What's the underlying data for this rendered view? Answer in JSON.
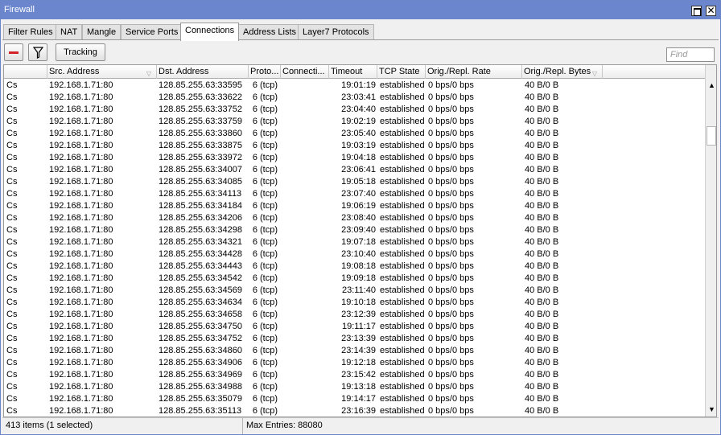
{
  "window": {
    "title": "Firewall"
  },
  "tabs": [
    "Filter Rules",
    "NAT",
    "Mangle",
    "Service Ports",
    "Connections",
    "Address Lists",
    "Layer7 Protocols"
  ],
  "active_tab": "Connections",
  "toolbar": {
    "tracking_label": "Tracking",
    "find_placeholder": "Find"
  },
  "columns": {
    "src": "Src. Address",
    "dst": "Dst. Address",
    "proto": "Proto...",
    "conn": "Connecti...",
    "timeout": "Timeout",
    "state": "TCP State",
    "rate": "Orig./Repl. Rate",
    "bytes": "Orig./Repl. Bytes"
  },
  "rows": [
    {
      "flag": "Cs",
      "src": "192.168.1.71:80",
      "dst": "128.85.255.63:33595",
      "proto": "6 (tcp)",
      "timeout": "19:01:19",
      "state": "established",
      "rate": "0 bps/0 bps",
      "bytes": "40 B/0 B"
    },
    {
      "flag": "Cs",
      "src": "192.168.1.71:80",
      "dst": "128.85.255.63:33622",
      "proto": "6 (tcp)",
      "timeout": "23:03:41",
      "state": "established",
      "rate": "0 bps/0 bps",
      "bytes": "40 B/0 B"
    },
    {
      "flag": "Cs",
      "src": "192.168.1.71:80",
      "dst": "128.85.255.63:33752",
      "proto": "6 (tcp)",
      "timeout": "23:04:40",
      "state": "established",
      "rate": "0 bps/0 bps",
      "bytes": "40 B/0 B"
    },
    {
      "flag": "Cs",
      "src": "192.168.1.71:80",
      "dst": "128.85.255.63:33759",
      "proto": "6 (tcp)",
      "timeout": "19:02:19",
      "state": "established",
      "rate": "0 bps/0 bps",
      "bytes": "40 B/0 B"
    },
    {
      "flag": "Cs",
      "src": "192.168.1.71:80",
      "dst": "128.85.255.63:33860",
      "proto": "6 (tcp)",
      "timeout": "23:05:40",
      "state": "established",
      "rate": "0 bps/0 bps",
      "bytes": "40 B/0 B"
    },
    {
      "flag": "Cs",
      "src": "192.168.1.71:80",
      "dst": "128.85.255.63:33875",
      "proto": "6 (tcp)",
      "timeout": "19:03:19",
      "state": "established",
      "rate": "0 bps/0 bps",
      "bytes": "40 B/0 B"
    },
    {
      "flag": "Cs",
      "src": "192.168.1.71:80",
      "dst": "128.85.255.63:33972",
      "proto": "6 (tcp)",
      "timeout": "19:04:18",
      "state": "established",
      "rate": "0 bps/0 bps",
      "bytes": "40 B/0 B"
    },
    {
      "flag": "Cs",
      "src": "192.168.1.71:80",
      "dst": "128.85.255.63:34007",
      "proto": "6 (tcp)",
      "timeout": "23:06:41",
      "state": "established",
      "rate": "0 bps/0 bps",
      "bytes": "40 B/0 B"
    },
    {
      "flag": "Cs",
      "src": "192.168.1.71:80",
      "dst": "128.85.255.63:34085",
      "proto": "6 (tcp)",
      "timeout": "19:05:18",
      "state": "established",
      "rate": "0 bps/0 bps",
      "bytes": "40 B/0 B"
    },
    {
      "flag": "Cs",
      "src": "192.168.1.71:80",
      "dst": "128.85.255.63:34113",
      "proto": "6 (tcp)",
      "timeout": "23:07:40",
      "state": "established",
      "rate": "0 bps/0 bps",
      "bytes": "40 B/0 B"
    },
    {
      "flag": "Cs",
      "src": "192.168.1.71:80",
      "dst": "128.85.255.63:34184",
      "proto": "6 (tcp)",
      "timeout": "19:06:19",
      "state": "established",
      "rate": "0 bps/0 bps",
      "bytes": "40 B/0 B"
    },
    {
      "flag": "Cs",
      "src": "192.168.1.71:80",
      "dst": "128.85.255.63:34206",
      "proto": "6 (tcp)",
      "timeout": "23:08:40",
      "state": "established",
      "rate": "0 bps/0 bps",
      "bytes": "40 B/0 B"
    },
    {
      "flag": "Cs",
      "src": "192.168.1.71:80",
      "dst": "128.85.255.63:34298",
      "proto": "6 (tcp)",
      "timeout": "23:09:40",
      "state": "established",
      "rate": "0 bps/0 bps",
      "bytes": "40 B/0 B"
    },
    {
      "flag": "Cs",
      "src": "192.168.1.71:80",
      "dst": "128.85.255.63:34321",
      "proto": "6 (tcp)",
      "timeout": "19:07:18",
      "state": "established",
      "rate": "0 bps/0 bps",
      "bytes": "40 B/0 B"
    },
    {
      "flag": "Cs",
      "src": "192.168.1.71:80",
      "dst": "128.85.255.63:34428",
      "proto": "6 (tcp)",
      "timeout": "23:10:40",
      "state": "established",
      "rate": "0 bps/0 bps",
      "bytes": "40 B/0 B"
    },
    {
      "flag": "Cs",
      "src": "192.168.1.71:80",
      "dst": "128.85.255.63:34443",
      "proto": "6 (tcp)",
      "timeout": "19:08:18",
      "state": "established",
      "rate": "0 bps/0 bps",
      "bytes": "40 B/0 B"
    },
    {
      "flag": "Cs",
      "src": "192.168.1.71:80",
      "dst": "128.85.255.63:34542",
      "proto": "6 (tcp)",
      "timeout": "19:09:18",
      "state": "established",
      "rate": "0 bps/0 bps",
      "bytes": "40 B/0 B"
    },
    {
      "flag": "Cs",
      "src": "192.168.1.71:80",
      "dst": "128.85.255.63:34569",
      "proto": "6 (tcp)",
      "timeout": "23:11:40",
      "state": "established",
      "rate": "0 bps/0 bps",
      "bytes": "40 B/0 B"
    },
    {
      "flag": "Cs",
      "src": "192.168.1.71:80",
      "dst": "128.85.255.63:34634",
      "proto": "6 (tcp)",
      "timeout": "19:10:18",
      "state": "established",
      "rate": "0 bps/0 bps",
      "bytes": "40 B/0 B"
    },
    {
      "flag": "Cs",
      "src": "192.168.1.71:80",
      "dst": "128.85.255.63:34658",
      "proto": "6 (tcp)",
      "timeout": "23:12:39",
      "state": "established",
      "rate": "0 bps/0 bps",
      "bytes": "40 B/0 B"
    },
    {
      "flag": "Cs",
      "src": "192.168.1.71:80",
      "dst": "128.85.255.63:34750",
      "proto": "6 (tcp)",
      "timeout": "19:11:17",
      "state": "established",
      "rate": "0 bps/0 bps",
      "bytes": "40 B/0 B"
    },
    {
      "flag": "Cs",
      "src": "192.168.1.71:80",
      "dst": "128.85.255.63:34752",
      "proto": "6 (tcp)",
      "timeout": "23:13:39",
      "state": "established",
      "rate": "0 bps/0 bps",
      "bytes": "40 B/0 B"
    },
    {
      "flag": "Cs",
      "src": "192.168.1.71:80",
      "dst": "128.85.255.63:34860",
      "proto": "6 (tcp)",
      "timeout": "23:14:39",
      "state": "established",
      "rate": "0 bps/0 bps",
      "bytes": "40 B/0 B"
    },
    {
      "flag": "Cs",
      "src": "192.168.1.71:80",
      "dst": "128.85.255.63:34906",
      "proto": "6 (tcp)",
      "timeout": "19:12:18",
      "state": "established",
      "rate": "0 bps/0 bps",
      "bytes": "40 B/0 B"
    },
    {
      "flag": "Cs",
      "src": "192.168.1.71:80",
      "dst": "128.85.255.63:34969",
      "proto": "6 (tcp)",
      "timeout": "23:15:42",
      "state": "established",
      "rate": "0 bps/0 bps",
      "bytes": "40 B/0 B"
    },
    {
      "flag": "Cs",
      "src": "192.168.1.71:80",
      "dst": "128.85.255.63:34988",
      "proto": "6 (tcp)",
      "timeout": "19:13:18",
      "state": "established",
      "rate": "0 bps/0 bps",
      "bytes": "40 B/0 B"
    },
    {
      "flag": "Cs",
      "src": "192.168.1.71:80",
      "dst": "128.85.255.63:35079",
      "proto": "6 (tcp)",
      "timeout": "19:14:17",
      "state": "established",
      "rate": "0 bps/0 bps",
      "bytes": "40 B/0 B"
    },
    {
      "flag": "Cs",
      "src": "192.168.1.71:80",
      "dst": "128.85.255.63:35113",
      "proto": "6 (tcp)",
      "timeout": "23:16:39",
      "state": "established",
      "rate": "0 bps/0 bps",
      "bytes": "40 B/0 B"
    }
  ],
  "status": {
    "items": "413 items (1 selected)",
    "max_entries": "Max Entries: 88080"
  },
  "colors": {
    "titlebar": "#6b86cc",
    "remove_icon": "#d2232a"
  },
  "icons": {
    "remove": "minus-icon",
    "filter": "filter-icon",
    "restore": "restore-window-icon",
    "close": "close-icon"
  }
}
